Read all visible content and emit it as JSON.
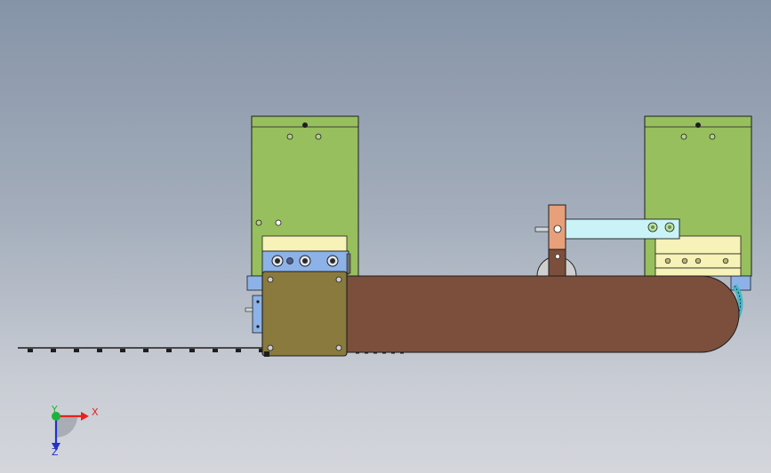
{
  "triad": {
    "x_label": "X",
    "y_label": "Y",
    "z_label": "Z",
    "x_color": "#e8211b",
    "y_color": "#1fb23a",
    "z_color": "#2233c8"
  },
  "colors": {
    "background_top": "#8694a8",
    "background_bottom": "#d4d6dc",
    "block_green": "#97bf5e",
    "plate_yellow": "#f6f2b8",
    "plate_blue": "#8db2e8",
    "belt_brown": "#7b4f3c",
    "motor_olive": "#8a7a3e",
    "arm_cyan": "#c9f3f7",
    "post_orange": "#e7a07a",
    "outline": "#1e1e1e"
  },
  "icons": {
    "triad": "axis-triad-icon"
  }
}
